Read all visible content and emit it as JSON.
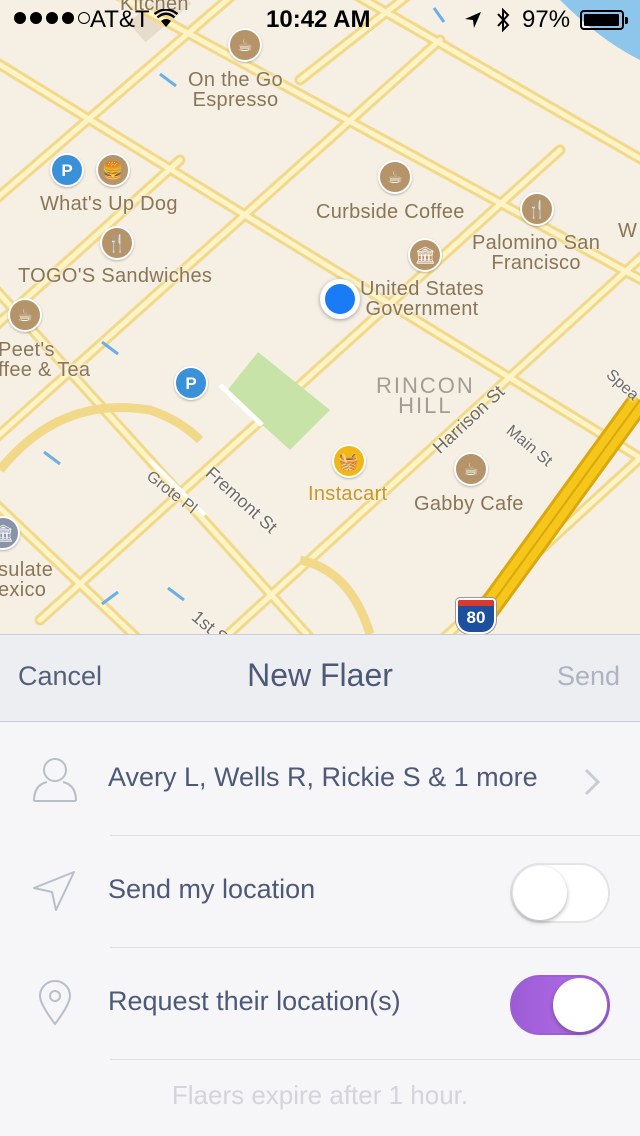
{
  "status_bar": {
    "carrier": "AT&T",
    "time": "10:42 AM",
    "battery": "97%",
    "battery_level": 0.97
  },
  "map": {
    "places": [
      {
        "name": "On the Go Espresso",
        "line1": "On the Go",
        "line2": "Espresso",
        "icon": "coffee-icon"
      },
      {
        "name": "What's Up Dog",
        "line1": "What's Up Dog",
        "icon": "fast-food-icon"
      },
      {
        "name": "Curbside Coffee",
        "line1": "Curbside Coffee",
        "icon": "coffee-icon"
      },
      {
        "name": "Palomino San Francisco",
        "line1": "Palomino San",
        "line2": "Francisco",
        "icon": "restaurant-icon"
      },
      {
        "name": "TOGO'S Sandwiches",
        "line1": "TOGO'S Sandwiches",
        "icon": "restaurant-icon"
      },
      {
        "name": "United States Government",
        "line1": "United States",
        "line2": "Government",
        "icon": "government-icon"
      },
      {
        "name": "Peet's Coffee & Tea",
        "line1": "Peet's",
        "line2": "ffee & Tea",
        "icon": "coffee-icon"
      },
      {
        "name": "Instacart",
        "line1": "Instacart",
        "icon": "basket-icon"
      },
      {
        "name": "Gabby Cafe",
        "line1": "Gabby Cafe",
        "icon": "coffee-icon"
      },
      {
        "name": "Consulate Mexico",
        "line1": "sulate",
        "line2": "exico",
        "icon": "consulate-icon"
      }
    ],
    "district": {
      "line1": "RINCON",
      "line2": "HILL"
    },
    "streets": [
      "Fremont St",
      "Harrison St",
      "Main St",
      "Grote Pl",
      "1st S",
      "Spea",
      "Kitchen",
      "W"
    ],
    "highway_shield": "80",
    "colors": {
      "road": "#fdd96b",
      "road_edge": "#e8c25a",
      "park": "#c8e3a8",
      "water": "#8ec5ea",
      "highway": "#f7c61a",
      "user_dot": "#1a7cf5"
    }
  },
  "nav": {
    "cancel": "Cancel",
    "title": "New Flaer",
    "send": "Send"
  },
  "form": {
    "recipients": {
      "text": "Avery L, Wells R, Rickie S & 1 more",
      "icon": "person-icon"
    },
    "send_location": {
      "label": "Send my location",
      "icon": "location-arrow-icon",
      "enabled": false
    },
    "request_location": {
      "label": "Request their location(s)",
      "icon": "map-pin-icon",
      "enabled": true
    },
    "footer": "Flaers expire after 1 hour."
  },
  "colors": {
    "accent": "#a867e0",
    "text": "#4d5a77",
    "muted": "#adb3c0"
  }
}
